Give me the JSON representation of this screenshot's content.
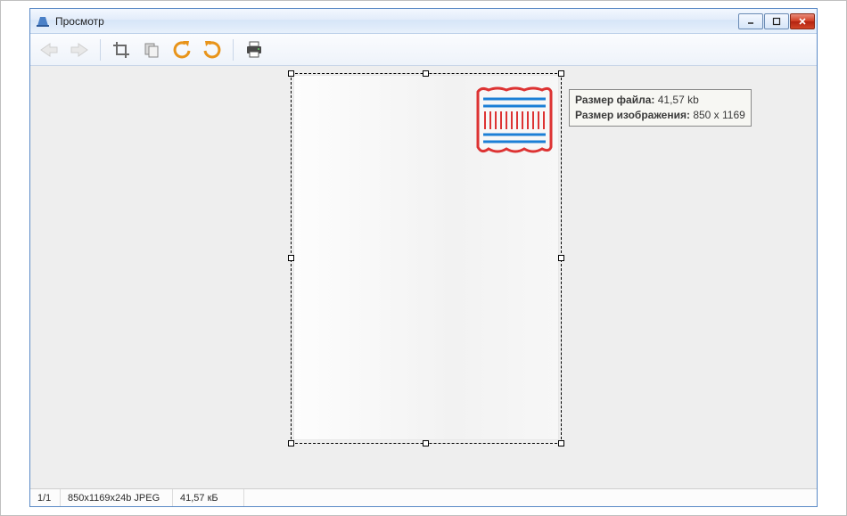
{
  "window": {
    "title": "Просмотр"
  },
  "toolbar": {
    "prev_label": "Назад",
    "next_label": "Вперед",
    "crop_label": "Обрезать",
    "copy_label": "Копировать",
    "rotate_left_label": "Повернуть влево",
    "rotate_right_label": "Повернуть вправо",
    "print_label": "Печать"
  },
  "tooltip": {
    "line1_label": "Размер файла:",
    "line1_value": "41,57 kb",
    "line2_label": "Размер изображения:",
    "line2_value": "850 x 1169"
  },
  "status": {
    "page": "1/1",
    "dimensions": "850x1169x24b JPEG",
    "filesize": "41,57 кБ"
  }
}
